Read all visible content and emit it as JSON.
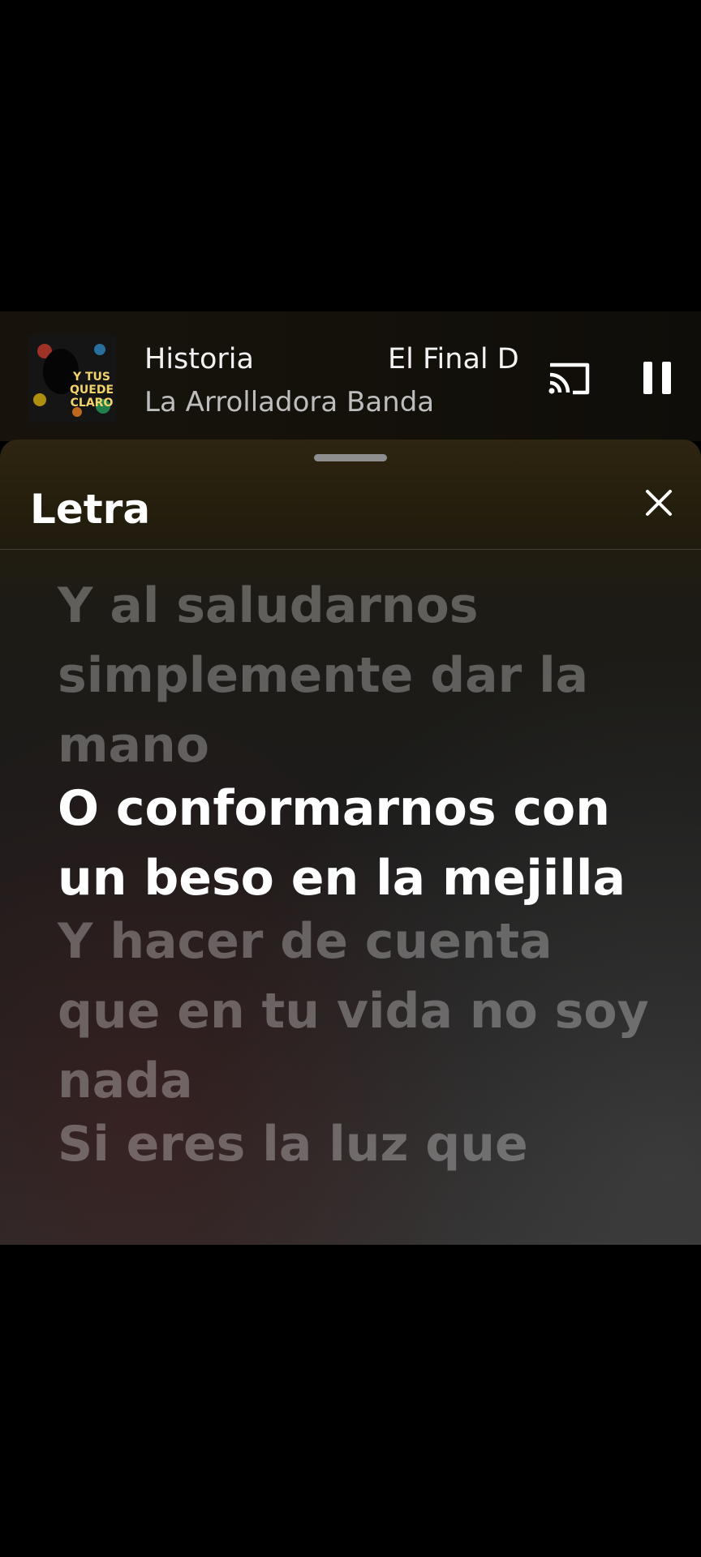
{
  "mini_player": {
    "title_part_a": "Historia",
    "title_part_b": "El Final D",
    "artist": "La Arrolladora Banda",
    "album_art_icon": "album-cover",
    "cast_icon": "cast-icon",
    "pause_icon": "pause-icon"
  },
  "lyrics_sheet": {
    "title": "Letra",
    "close_icon": "close-icon",
    "lines": [
      "Y al saludarnos simplemente dar la mano",
      "O conformarnos con un beso en la mejilla",
      "Y hacer de cuenta que en tu vida no soy nada",
      "Si eres la luz que"
    ],
    "active_line_index": 1
  },
  "colors": {
    "background": "#000000",
    "active_lyric": "#ffffff",
    "inactive_lyric": "rgba(255,255,255,0.30)"
  }
}
